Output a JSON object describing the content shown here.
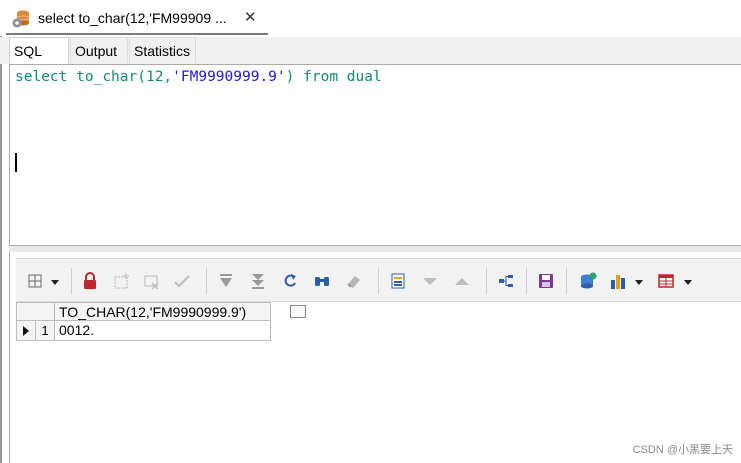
{
  "window": {
    "tab_title": "select to_char(12,'FM99909 ...",
    "tab_icon": "database-gear-icon",
    "close_glyph": "✕"
  },
  "sub_tabs": [
    {
      "label": "SQL",
      "active": true
    },
    {
      "label": "Output",
      "active": false
    },
    {
      "label": "Statistics",
      "active": false
    }
  ],
  "editor": {
    "tokens": {
      "select": "select",
      "func": "to_char(12,",
      "literal": "'FM9990999.9'",
      "close": ")",
      "from": "from",
      "table": "dual"
    }
  },
  "toolbar": {
    "buttons": [
      "grid-options-icon",
      "lock-icon",
      "insert-record-icon",
      "delete-record-icon",
      "post-changes-icon",
      "fetch-next-icon",
      "fetch-last-icon",
      "refresh-icon",
      "find-icon",
      "clear-icon",
      "single-record-icon",
      "next-record-icon",
      "previous-record-icon",
      "query-plan-icon",
      "save-icon",
      "export-icon",
      "chart-icon",
      "grid-layout-icon"
    ]
  },
  "grid": {
    "columns": [
      "TO_CHAR(12,'FM9990999.9')"
    ],
    "rows": [
      {
        "num": "1",
        "values": [
          "0012."
        ]
      }
    ]
  },
  "watermark": "CSDN @小黑要上天",
  "colors": {
    "keyword": "#12897a",
    "string": "#1a1adf",
    "tab_underline": "#7a7a7a"
  }
}
